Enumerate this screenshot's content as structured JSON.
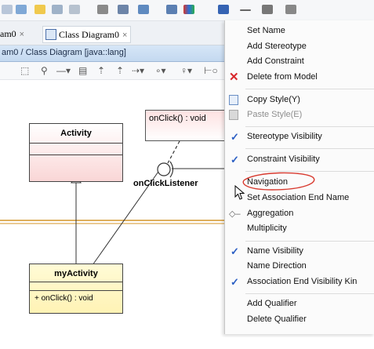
{
  "tabs": [
    {
      "label": "am0",
      "close": "×"
    },
    {
      "label": "Class Diagram0",
      "close": "×"
    }
  ],
  "title_bar": {
    "text": "am0 / Class Diagram [java::lang]"
  },
  "diagram": {
    "note": {
      "text": "onClick() : void"
    },
    "interface": {
      "label": "onClickListener"
    },
    "class_activity": {
      "name": "Activity"
    },
    "class_myactivity": {
      "name": "myActivity",
      "operation": "+ onClick() : void"
    }
  },
  "menu": {
    "items": [
      {
        "label": "Set Name"
      },
      {
        "label": "Add Stereotype"
      },
      {
        "label": "Add Constraint"
      },
      {
        "label": "Delete from Model"
      },
      {
        "label": "Copy Style(Y)"
      },
      {
        "label": "Paste Style(E)"
      },
      {
        "label": "Stereotype Visibility"
      },
      {
        "label": "Constraint Visibility"
      },
      {
        "label": "Navigation"
      },
      {
        "label": "Set Association End Name"
      },
      {
        "label": "Aggregation"
      },
      {
        "label": "Multiplicity"
      },
      {
        "label": "Name Visibility"
      },
      {
        "label": "Name Direction"
      },
      {
        "label": "Association End Visibility Kin"
      },
      {
        "label": "Add Qualifier"
      },
      {
        "label": "Delete Qualifier"
      }
    ]
  },
  "colors": {
    "accent_check": "#2b5fc4",
    "delete_icon": "#d8262a",
    "annotation_circle": "#d83a2f",
    "class_fill_pink": "#fde7e7",
    "class_fill_yellow": "#fffbd6",
    "association_line": "#d4952a"
  }
}
